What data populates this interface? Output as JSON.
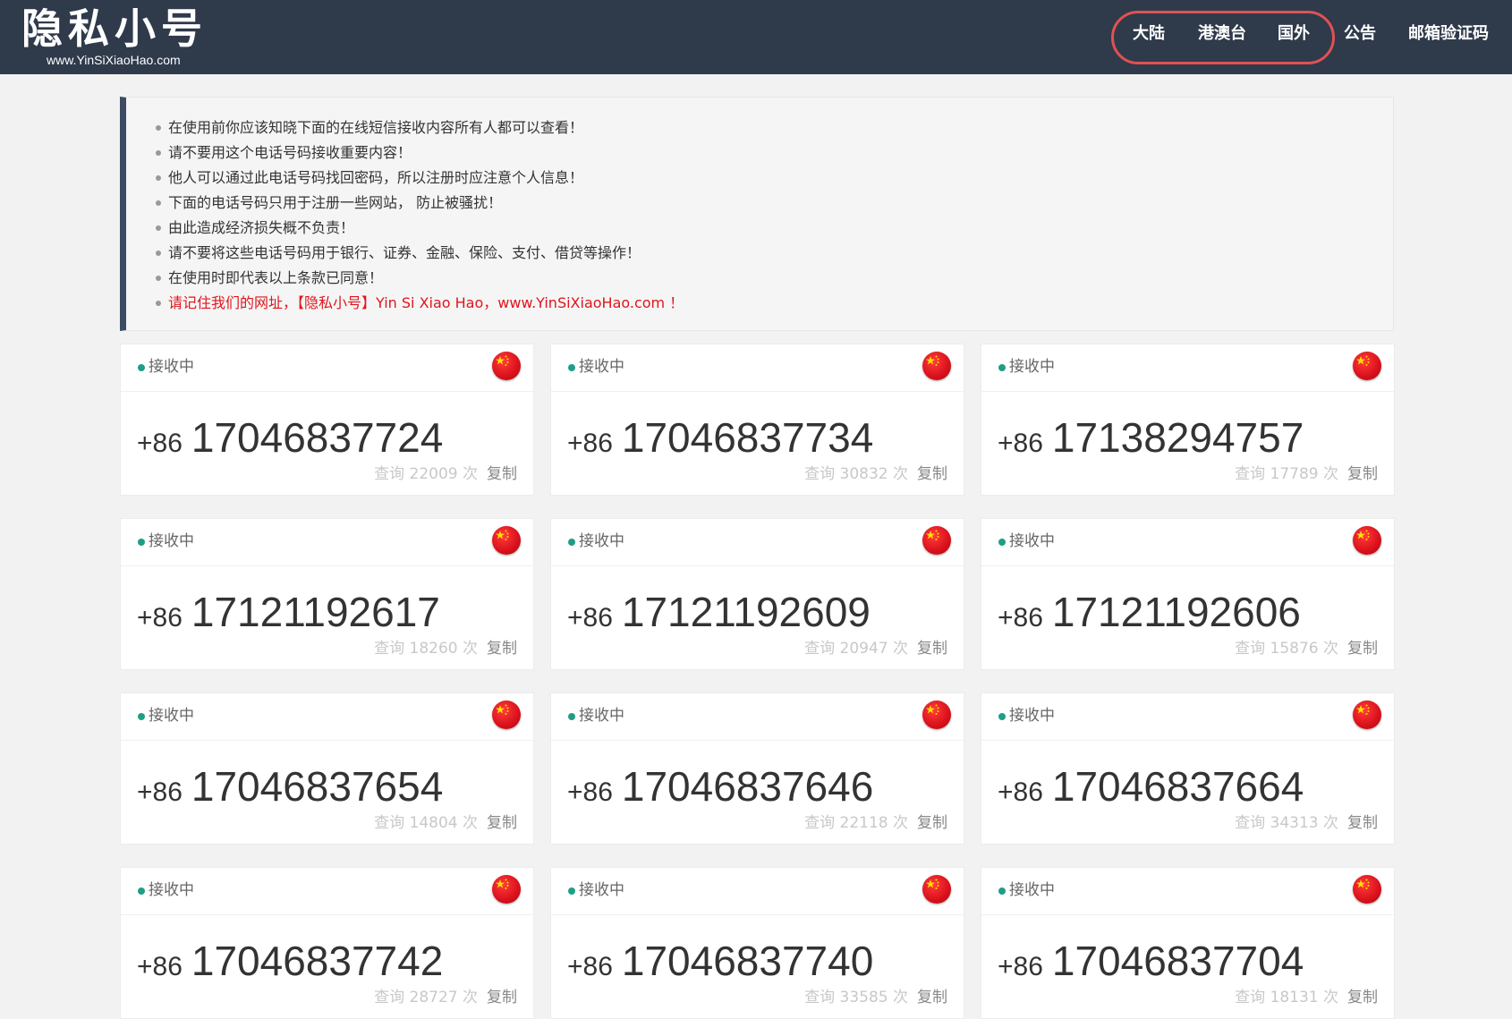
{
  "header": {
    "logo_title": "隐私小号",
    "logo_subtitle": "www.YinSiXiaoHao.com",
    "nav": [
      "大陆",
      "港澳台",
      "国外",
      "公告",
      "邮箱验证码"
    ]
  },
  "notice": {
    "items": [
      "在使用前你应该知晓下面的在线短信接收内容所有人都可以查看！",
      "请不要用这个电话号码接收重要内容！",
      "他人可以通过此电话号码找回密码，所以注册时应注意个人信息！",
      "下面的电话号码只用于注册一些网站， 防止被骚扰！",
      "由此造成经济损失概不负责！",
      "请不要将这些电话号码用于银行、证券、金融、保险、支付、借贷等操作！",
      "在使用时即代表以上条款已同意！"
    ],
    "highlight": "请记住我们的网址，【隐私小号】Yin Si Xiao Hao，www.YinSiXiaoHao.com ！"
  },
  "colors": {
    "header_bg": "#2f3a4b",
    "status_green": "#1e9e86",
    "highlight_red": "#e0151c",
    "nav_ring": "#e05252"
  },
  "cards": [
    {
      "status": "接收中",
      "flag": "china-flag-icon",
      "country_code": "+86",
      "number": "17046837724",
      "query": "查询 22009 次",
      "copy": "复制"
    },
    {
      "status": "接收中",
      "flag": "china-flag-icon",
      "country_code": "+86",
      "number": "17046837734",
      "query": "查询 30832 次",
      "copy": "复制"
    },
    {
      "status": "接收中",
      "flag": "china-flag-icon",
      "country_code": "+86",
      "number": "17138294757",
      "query": "查询 17789 次",
      "copy": "复制"
    },
    {
      "status": "接收中",
      "flag": "china-flag-icon",
      "country_code": "+86",
      "number": "17121192617",
      "query": "查询 18260 次",
      "copy": "复制"
    },
    {
      "status": "接收中",
      "flag": "china-flag-icon",
      "country_code": "+86",
      "number": "17121192609",
      "query": "查询 20947 次",
      "copy": "复制"
    },
    {
      "status": "接收中",
      "flag": "china-flag-icon",
      "country_code": "+86",
      "number": "17121192606",
      "query": "查询 15876 次",
      "copy": "复制"
    },
    {
      "status": "接收中",
      "flag": "china-flag-icon",
      "country_code": "+86",
      "number": "17046837654",
      "query": "查询 14804 次",
      "copy": "复制"
    },
    {
      "status": "接收中",
      "flag": "china-flag-icon",
      "country_code": "+86",
      "number": "17046837646",
      "query": "查询 22118 次",
      "copy": "复制"
    },
    {
      "status": "接收中",
      "flag": "china-flag-icon",
      "country_code": "+86",
      "number": "17046837664",
      "query": "查询 34313 次",
      "copy": "复制"
    },
    {
      "status": "接收中",
      "flag": "china-flag-icon",
      "country_code": "+86",
      "number": "17046837742",
      "query": "查询 28727 次",
      "copy": "复制"
    },
    {
      "status": "接收中",
      "flag": "china-flag-icon",
      "country_code": "+86",
      "number": "17046837740",
      "query": "查询 33585 次",
      "copy": "复制"
    },
    {
      "status": "接收中",
      "flag": "china-flag-icon",
      "country_code": "+86",
      "number": "17046837704",
      "query": "查询 18131 次",
      "copy": "复制"
    }
  ]
}
